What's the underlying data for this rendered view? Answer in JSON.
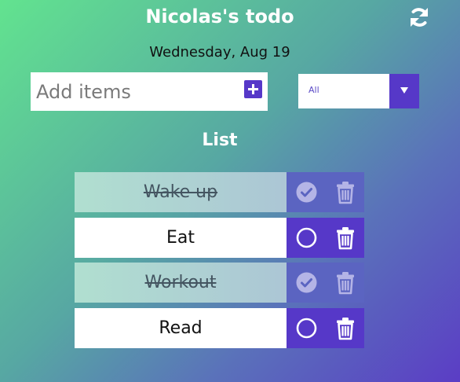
{
  "header": {
    "title": "Nicolas's todo",
    "date": "Wednesday, Aug 19",
    "refresh_icon": "refresh-icon"
  },
  "add_item": {
    "placeholder": "Add items",
    "value": "",
    "add_icon": "plus-square-icon"
  },
  "filter": {
    "selected": "All",
    "arrow_icon": "caret-down-icon"
  },
  "list": {
    "title": "List",
    "items": [
      {
        "text": "Wake up",
        "completed": true
      },
      {
        "text": "Eat",
        "completed": false
      },
      {
        "text": "Workout",
        "completed": true
      },
      {
        "text": "Read",
        "completed": false
      }
    ]
  },
  "colors": {
    "accent": "#5638c8",
    "gradient_start": "#62e38f",
    "gradient_end": "#5b3dc5",
    "done_bg_start": "#b0dfd0",
    "done_bg_end": "#acc6d5"
  }
}
